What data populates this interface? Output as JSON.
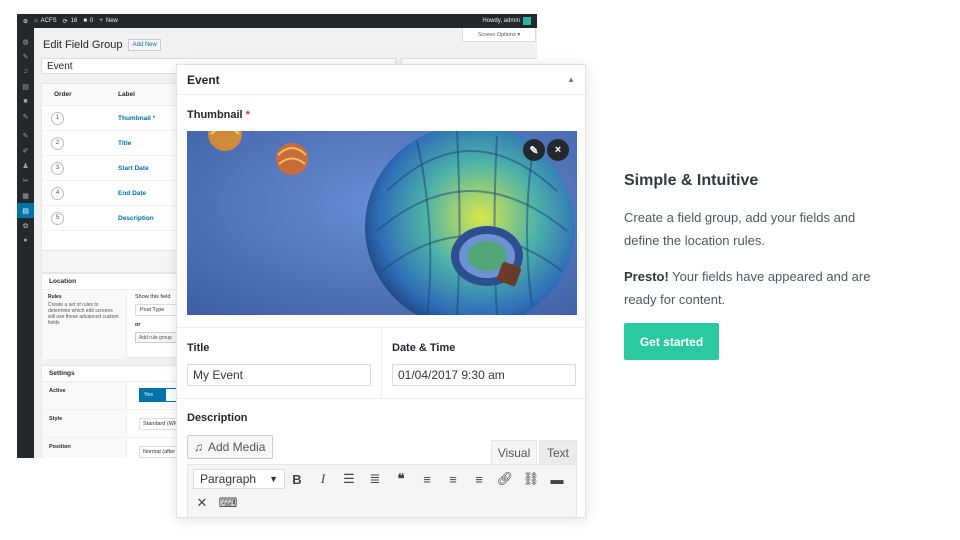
{
  "admin_bar": {
    "site_name": "ACFS",
    "updates_count": "16",
    "comments_count": "0",
    "new_label": "New",
    "howdy": "Howdy, admin"
  },
  "admin_page": {
    "title": "Edit Field Group",
    "add_new": "Add New",
    "screen_options": "Screen Options ▾",
    "group_title_value": "Event",
    "fields_table": {
      "columns": [
        "Order",
        "Label"
      ],
      "rows": [
        {
          "order": "1",
          "label": "Thumbnail",
          "required": true
        },
        {
          "order": "2",
          "label": "Title",
          "required": false
        },
        {
          "order": "3",
          "label": "Start Date",
          "required": false
        },
        {
          "order": "4",
          "label": "End Date",
          "required": false
        },
        {
          "order": "5",
          "label": "Description",
          "required": false
        }
      ]
    },
    "location": {
      "heading": "Location",
      "rules_label": "Rules",
      "rules_help": "Create a set of rules to determine which edit screens will use these advanced custom fields",
      "show_label": "Show this field",
      "param_value": "Post Type",
      "or_label": "or",
      "add_rule_group": "Add rule group"
    },
    "settings": {
      "heading": "Settings",
      "active_label": "Active",
      "active_value": "Yes",
      "style_label": "Style",
      "style_value": "Standard (WP",
      "position_label": "Position",
      "position_value": "Normal (after"
    }
  },
  "event_card": {
    "title": "Event",
    "thumbnail_label": "Thumbnail",
    "required_mark": "*",
    "title_label": "Title",
    "title_value": "My Event",
    "datetime_label": "Date & Time",
    "datetime_value": "01/04/2017 9:30 am",
    "description_label": "Description",
    "add_media": "Add Media",
    "tab_visual": "Visual",
    "tab_text": "Text",
    "format_select": "Paragraph"
  },
  "promo": {
    "heading": "Simple & Intuitive",
    "paragraph1": "Create a field group, add your fields and define the location rules.",
    "paragraph2_strong": "Presto!",
    "paragraph2_rest": " Your fields have appeared and are ready for content.",
    "cta": "Get started"
  },
  "colors": {
    "cta": "#2bc9a2",
    "wp_dark": "#23282d",
    "wp_blue": "#0073aa",
    "required": "#dc3232"
  },
  "icons": {
    "edit_image": "pencil-icon",
    "remove_image": "close-icon",
    "add_media": "media-icon",
    "collapse": "caret-up-icon"
  }
}
